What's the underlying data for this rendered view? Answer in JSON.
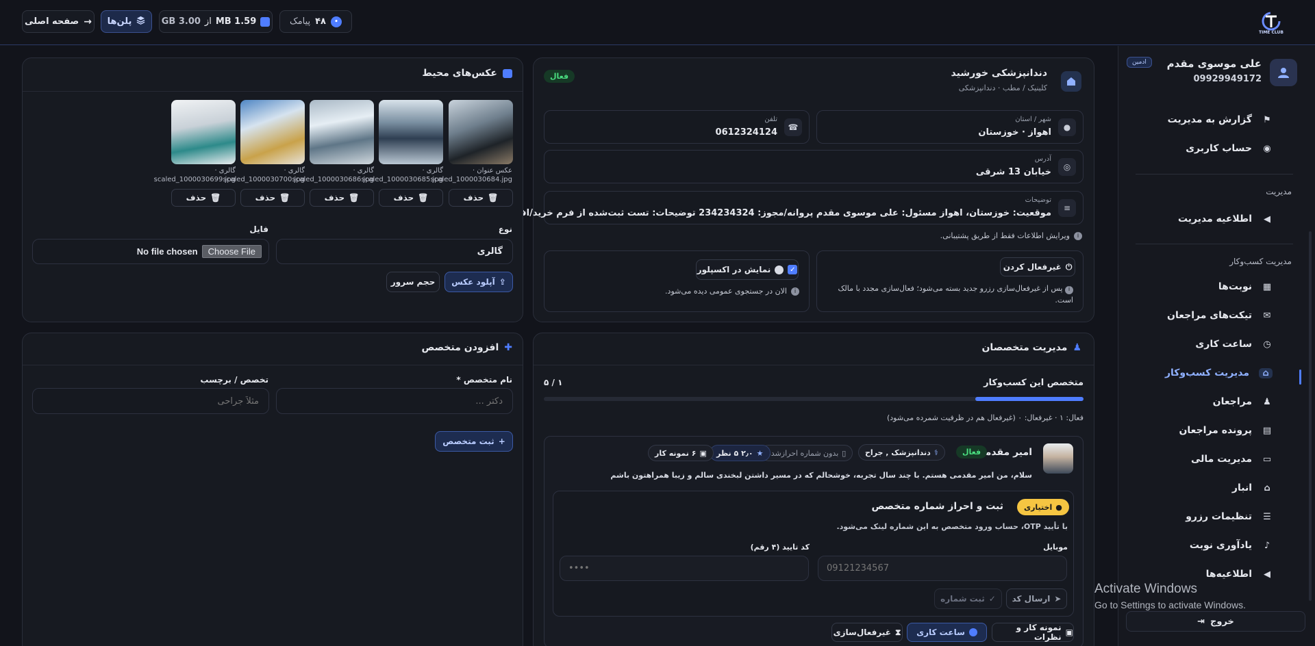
{
  "topbar": {
    "home_label": "صفحه اصلی",
    "plans_label": "پلن‌ها",
    "storage_used": "MB 1.59",
    "storage_sep": "از",
    "storage_total": "GB 3.00",
    "sms_count": "۴۸",
    "sms_label": "پیامک",
    "logo_text": "TIME CLUB"
  },
  "user": {
    "name": "علی موسوی مقدم",
    "phone": "09929949172",
    "role_badge": "ادمین"
  },
  "nav": {
    "report": "گزارش به مدیریت",
    "account": "حساب کاربری",
    "section_admin": "مدیریت",
    "admin_notice": "اطلاعیه مدیریت",
    "section_business": "مدیریت کسب‌وکار",
    "items": [
      {
        "label": "نوبت‌ها",
        "icon": "calendar-icon"
      },
      {
        "label": "تیکت‌های مراجعان",
        "icon": "chat-icon"
      },
      {
        "label": "ساعت کاری",
        "icon": "clock-icon"
      },
      {
        "label": "مدیریت کسب‌وکار",
        "icon": "store-icon"
      },
      {
        "label": "مراجعان",
        "icon": "users-icon"
      },
      {
        "label": "پرونده مراجعان",
        "icon": "file-icon"
      },
      {
        "label": "مدیریت مالی",
        "icon": "wallet-icon"
      },
      {
        "label": "انبار",
        "icon": "warehouse-icon"
      },
      {
        "label": "تنظیمات رزرو",
        "icon": "sliders-icon"
      },
      {
        "label": "یادآوری نوبت",
        "icon": "bell-icon"
      },
      {
        "label": "اطلاعیه‌ها",
        "icon": "megaphone-icon"
      }
    ],
    "logout": "خروج"
  },
  "watermark": {
    "line1": "Activate Windows",
    "line2": "Go to Settings to activate Windows."
  },
  "business": {
    "name": "دندانپزشکی خورشید",
    "subtitle": "کلینیک / مطب · دندانپزشکی",
    "status": "فعال",
    "city_label": "شهر / استان",
    "city_value": "اهواز · خوزستان",
    "phone_label": "تلفن",
    "phone_value": "0612324124",
    "address_label": "آدرس",
    "address_value": "خیابان 13 شرقی",
    "desc_label": "توضیحات",
    "desc_value": "موقعیت: خوزستان، اهواز مسئول: علی موسوی مقدم پروانه/مجوز: 234234324 توضیحات: تست ثبت‌شده از فرم خرید/افزودن اشتراک (ادمین)",
    "edit_note": "ویرایش اطلاعات فقط از طریق پشتیبانی.",
    "deactivate_label": "غیرفعال کردن",
    "deactivate_note": "پس از غیرفعال‌سازی رزرو جدید بسته می‌شود؛ فعال‌سازی مجدد با مالک است.",
    "explorer_label": "نمایش در اکسپلور",
    "explorer_note": "الان در جستجوی عمومی دیده می‌شود."
  },
  "gallery": {
    "title": "عکس‌های محیط",
    "photos": [
      {
        "caption1": "عکس عنوان ·",
        "caption2": "scaled_1000030684.jpg"
      },
      {
        "caption1": "گالری ·",
        "caption2": "scaled_1000030685.jpg"
      },
      {
        "caption1": "گالری ·",
        "caption2": "scaled_1000030686.jpg"
      },
      {
        "caption1": "گالری ·",
        "caption2": "scaled_1000030700.jpg"
      },
      {
        "caption1": "گالری ·",
        "caption2": "scaled_1000030699.jpg"
      }
    ],
    "delete_label": "حذف",
    "type_label": "نوع",
    "type_value": "گالری",
    "file_label": "فایل",
    "choose_file": "Choose File",
    "no_file": "No file chosen",
    "upload_label": "آپلود عکس",
    "server_size_label": "حجم سرور"
  },
  "add_specialist": {
    "title": "افزودن متخصص",
    "name_label": "نام متخصص *",
    "name_placeholder": "دکتر ...",
    "tag_label": "تخصص / برچسب",
    "tag_placeholder": "مثلاً جراحی",
    "submit_label": "ثبت متخصص"
  },
  "specialists": {
    "title": "مدیریت متخصصان",
    "section_label": "متخصص این کسب‌وکار",
    "count": "۱ / ۵",
    "capacity_fraction": 0.2,
    "stats": "فعال: ۱ · غیرفعال: ۰ (غیرفعال هم در ظرفیت شمرده می‌شود)",
    "person": {
      "name": "امیر مقدمی",
      "status": "فعال",
      "specialty": "دندانپزشک , جراح",
      "no_phone": "بدون شماره احرازشده",
      "rating": "۲٫۰ ۵ نظر",
      "samples": "۶ نمونه کار",
      "bio": "سلام، من امیر مقدمی هستم. با چند سال تجربه، خوشحالم که در مسیر داشتن لبخندی سالم و زیبا همراهتون باشم"
    },
    "verify": {
      "optional_badge": "اختیاری",
      "title": "ثبت و احراز شماره متخصص",
      "note": "با تأیید OTP، حساب ورود متخصص به این شماره لینک می‌شود.",
      "mobile_label": "موبایل",
      "mobile_placeholder": "09121234567",
      "code_label": "کد تایید (۴ رقم)",
      "code_placeholder": "••••",
      "send_code": "ارسال کد",
      "register_number": "ثبت شماره"
    },
    "actions": {
      "portfolio": "نمونه کار و نظرات",
      "hours": "ساعت کاری",
      "deactivate": "غیرفعال‌سازی"
    }
  },
  "colors": {
    "accent": "#4f7dff",
    "active_green": "#4ade80",
    "optional_yellow": "#f5c542"
  }
}
